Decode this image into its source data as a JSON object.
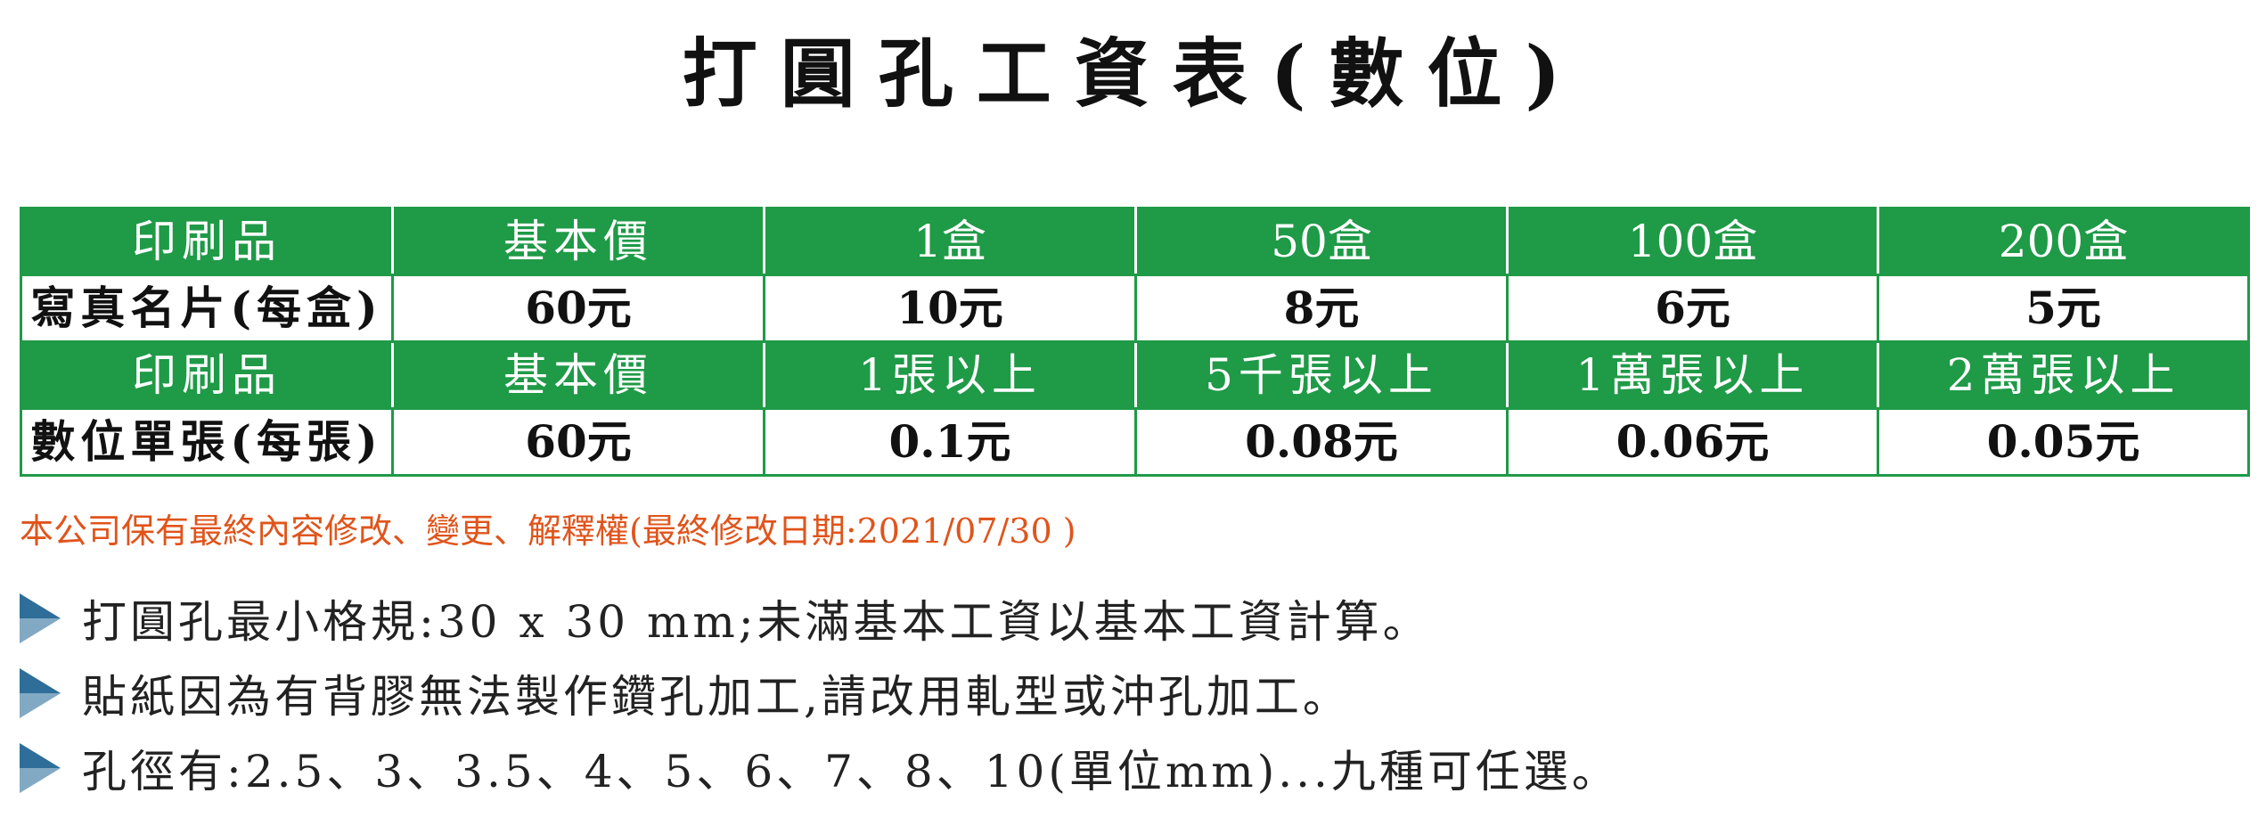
{
  "title": "打圓孔工資表(數位)",
  "table": {
    "card": {
      "header": [
        "印刷品",
        "基本價",
        "1盒",
        "50盒",
        "100盒",
        "200盒"
      ],
      "row": [
        "寫真名片(每盒)",
        "60元",
        "10元",
        "8元",
        "6元",
        "5元"
      ]
    },
    "sheet": {
      "header": [
        "印刷品",
        "基本價",
        "1張以上",
        "5千張以上",
        "1萬張以上",
        "2萬張以上"
      ],
      "row": [
        "數位單張(每張)",
        "60元",
        "0.1元",
        "0.08元",
        "0.06元",
        "0.05元"
      ]
    }
  },
  "disclaimer": "本公司保有最終內容修改、變更、解釋權(最終修改日期:2021/07/30 )",
  "notes": [
    {
      "icon": "triangle-bullet-icon",
      "text": "打圓孔最小格規:30 x 30 mm;未滿基本工資以基本工資計算。"
    },
    {
      "icon": "triangle-bullet-icon",
      "text": "貼紙因為有背膠無法製作鑽孔加工,請改用軋型或沖孔加工。"
    },
    {
      "icon": "triangle-bullet-icon",
      "text": "孔徑有:2.5、3、3.5、4、5、6、7、8、10(單位mm)...九種可任選。"
    }
  ],
  "colors": {
    "header_green": "#1f9a47",
    "disclaimer_orange": "#e0541b",
    "bullet_blue": "#2e6e99"
  }
}
